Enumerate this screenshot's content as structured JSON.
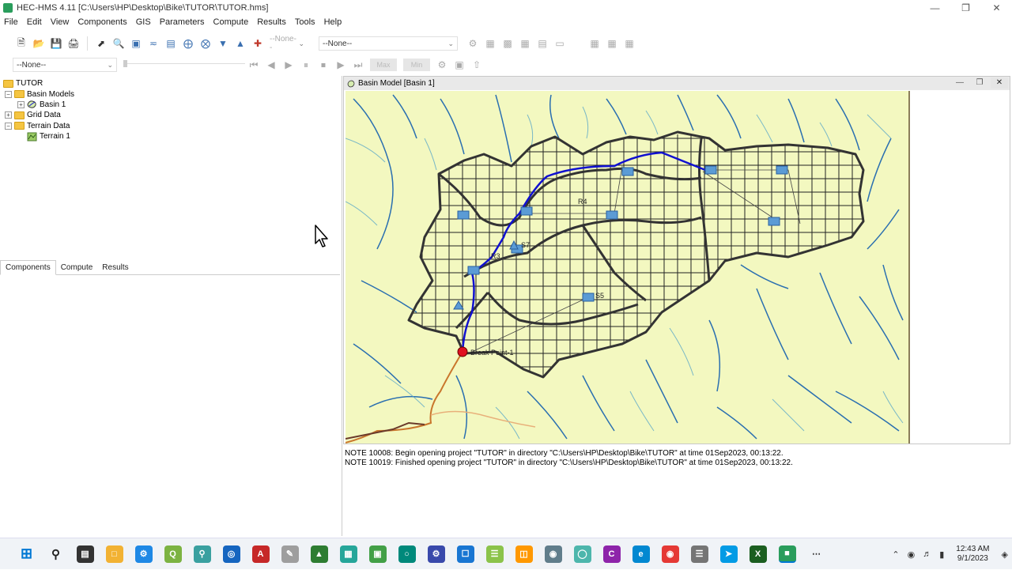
{
  "window": {
    "title": "HEC-HMS 4.11 [C:\\Users\\HP\\Desktop\\Bike\\TUTOR\\TUTOR.hms]"
  },
  "menu": [
    "File",
    "Edit",
    "View",
    "Components",
    "GIS",
    "Parameters",
    "Compute",
    "Results",
    "Tools",
    "Help"
  ],
  "toolbar": {
    "met_combo": "--None--",
    "main_combo": "--None--",
    "run_combo": "--None--",
    "max_label": "Max",
    "min_label": "Min"
  },
  "tree": {
    "root": "TUTOR",
    "basin_models": "Basin Models",
    "basin1": "Basin 1",
    "grid_data": "Grid Data",
    "terrain_data": "Terrain Data",
    "terrain1": "Terrain 1"
  },
  "tabs": [
    "Components",
    "Compute",
    "Results"
  ],
  "basin_window": {
    "title": "Basin Model [Basin 1]",
    "labels": {
      "outlet": "Break Point-1",
      "r4": "R4",
      "r3": "R3",
      "s5": "S5",
      "s7": "S7"
    }
  },
  "log": [
    "NOTE 10008:  Begin opening project \"TUTOR\" in directory \"C:\\Users\\HP\\Desktop\\Bike\\TUTOR\" at time 01Sep2023, 00:13:22.",
    "NOTE 10019:  Finished opening project \"TUTOR\" in directory \"C:\\Users\\HP\\Desktop\\Bike\\TUTOR\" at time 01Sep2023, 00:13:22."
  ],
  "taskbar": {
    "time": "12:43 AM",
    "date": "9/1/2023",
    "icons": [
      "windows-start",
      "search",
      "file-explorer",
      "folder",
      "settings",
      "qgis",
      "search-app",
      "arcgis",
      "acrobat",
      "sketch",
      "maps",
      "powerpoint",
      "photos",
      "hms",
      "app",
      "security",
      "notes",
      "store",
      "edge-like",
      "app2",
      "canva",
      "edge",
      "chrome",
      "app3",
      "telegram",
      "excel",
      "hms-active"
    ]
  },
  "colors": {
    "map_bg": "#f3f8c0",
    "stream": "#2a6fb0",
    "main_reach": "#1010d0",
    "boundary": "#333333",
    "accent": "#2a9d5c"
  }
}
